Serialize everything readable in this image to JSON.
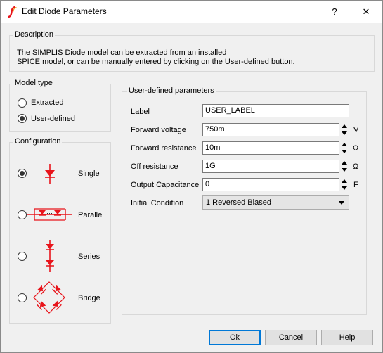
{
  "window": {
    "title": "Edit Diode Parameters",
    "help_glyph": "?",
    "close_glyph": "✕",
    "app_icon": "simplis-logo-icon"
  },
  "description": {
    "title": "Description",
    "line1": "The SIMPLIS Diode model can be extracted from an installed",
    "line2": "SPICE model, or can be manually entered by clicking on the User-defined button."
  },
  "model_type": {
    "title": "Model type",
    "options": [
      {
        "label": "Extracted",
        "checked": false
      },
      {
        "label": "User-defined",
        "checked": true
      }
    ]
  },
  "configuration": {
    "title": "Configuration",
    "options": [
      {
        "label": "Single",
        "checked": true,
        "icon": "single-diode-icon"
      },
      {
        "label": "Parallel",
        "checked": false,
        "icon": "parallel-diodes-icon"
      },
      {
        "label": "Series",
        "checked": false,
        "icon": "series-diodes-icon"
      },
      {
        "label": "Bridge",
        "checked": false,
        "icon": "bridge-diodes-icon"
      }
    ],
    "parallel_dots": "···"
  },
  "params": {
    "title": "User-defined parameters",
    "label": {
      "name": "Label",
      "value": "USER_LABEL"
    },
    "forward_voltage": {
      "name": "Forward voltage",
      "value": "750m",
      "unit": "V"
    },
    "forward_resistance": {
      "name": "Forward resistance",
      "value": "10m",
      "unit": "Ω"
    },
    "off_resistance": {
      "name": "Off resistance",
      "value": "1G",
      "unit": "Ω"
    },
    "output_capacitance": {
      "name": "Output Capacitance",
      "value": "0",
      "unit": "F"
    },
    "initial_condition": {
      "name": "Initial Condition",
      "value": "1 Reversed Biased"
    }
  },
  "buttons": {
    "ok": "Ok",
    "cancel": "Cancel",
    "help": "Help"
  },
  "colors": {
    "diode_red": "#e8141b",
    "accent_blue": "#0078d7"
  }
}
